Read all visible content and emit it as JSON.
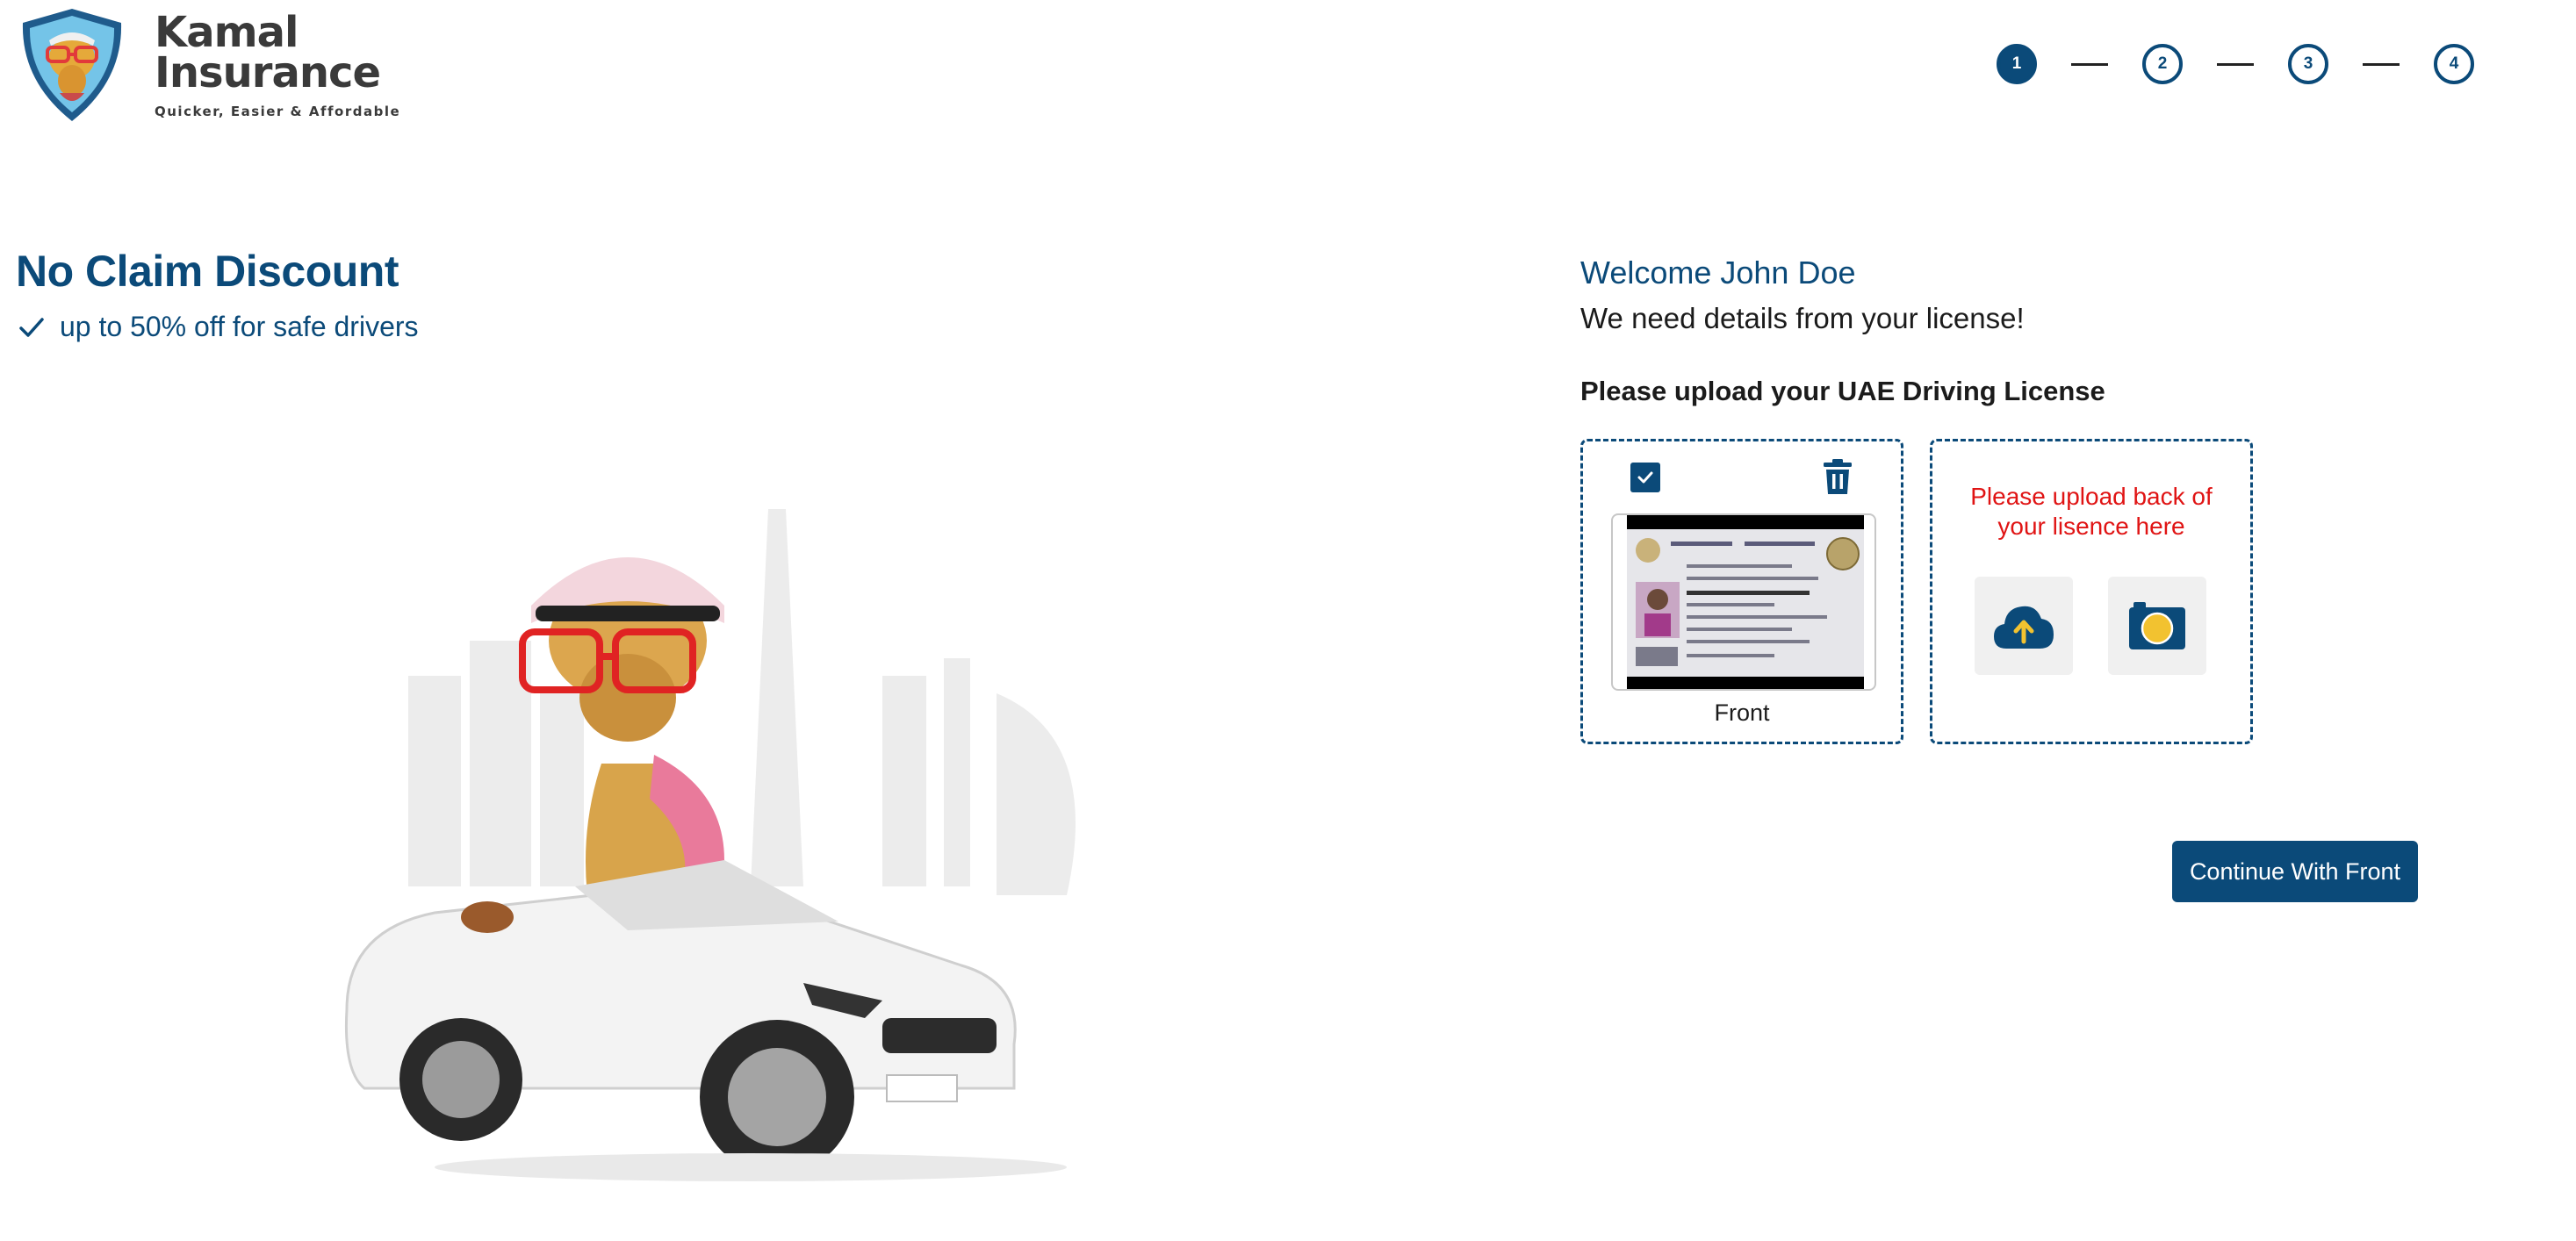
{
  "header": {
    "logo_name_line1": "Kamal",
    "logo_name_line2": "Insurance",
    "logo_tagline": "Quicker, Easier & Affordable",
    "steps": [
      "1",
      "2",
      "3",
      "4"
    ],
    "active_step": 1
  },
  "promo": {
    "title": "No Claim Discount",
    "point": "up to 50% off for safe drivers"
  },
  "form": {
    "welcome": "Welcome John Doe",
    "subtitle": "We need details from your license!",
    "upload_title": "Please upload your UAE Driving License",
    "front_card": {
      "label": "Front",
      "checked": true
    },
    "back_card": {
      "message": "Please upload back of your lisence here"
    },
    "continue_label": "Continue With Front"
  },
  "colors": {
    "primary": "#0b4a79",
    "error": "#e01414",
    "tile_bg": "#f0f0f0",
    "accent_yellow": "#f2c230"
  },
  "icons": {
    "check": "check-icon",
    "trash": "trash-icon",
    "upload": "cloud-upload-icon",
    "camera": "camera-icon"
  }
}
